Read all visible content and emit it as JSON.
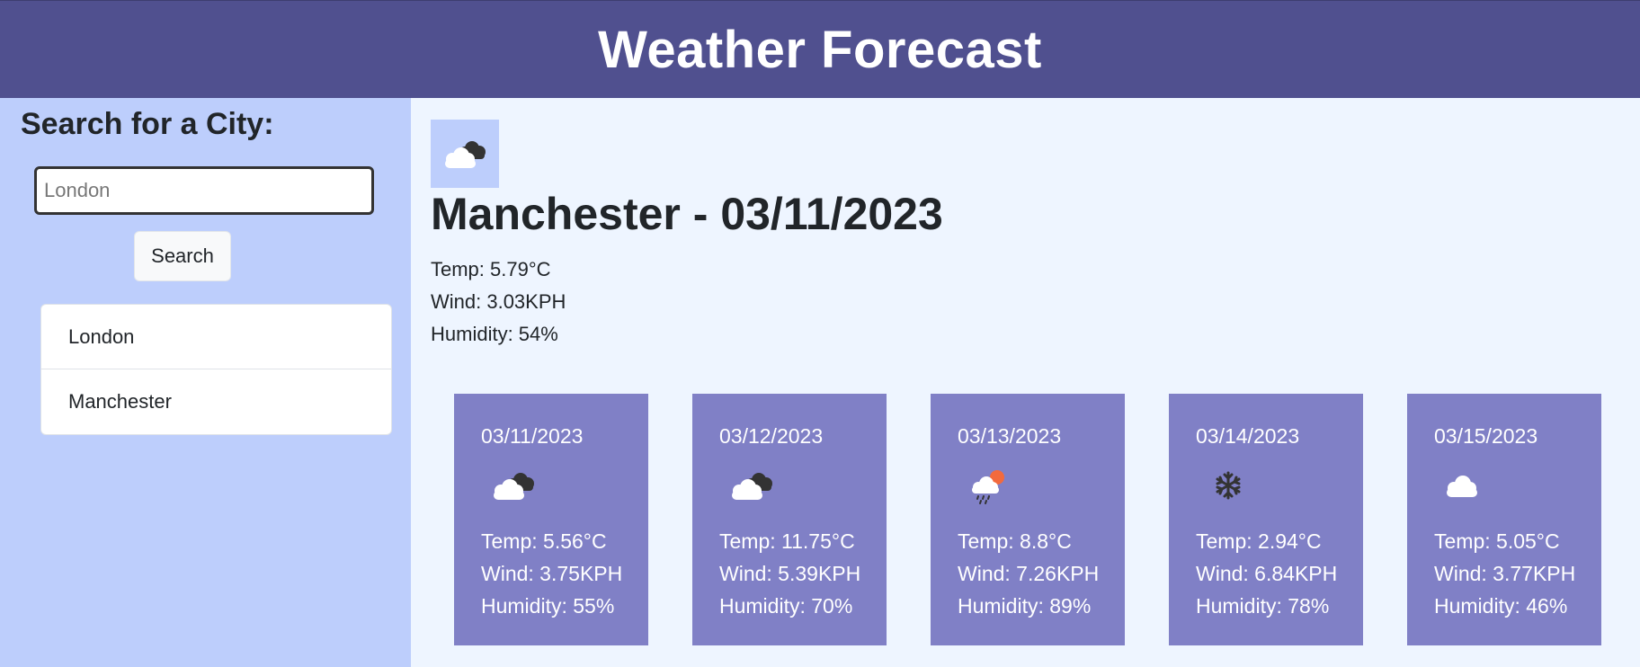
{
  "header": {
    "title": "Weather Forecast"
  },
  "sidebar": {
    "heading": "Search for a City:",
    "search_placeholder": "London",
    "search_button": "Search",
    "history": [
      "London",
      "Manchester"
    ]
  },
  "current": {
    "icon": "cloudy-icon",
    "title": "Manchester - 03/11/2023",
    "temp": "Temp: 5.79°C",
    "wind": "Wind: 3.03KPH",
    "humidity": "Humidity: 54%"
  },
  "forecast": [
    {
      "date": "03/11/2023",
      "icon": "cloudy-icon",
      "temp": "Temp: 5.56°C",
      "wind": "Wind: 3.75KPH",
      "humidity": "Humidity: 55%"
    },
    {
      "date": "03/12/2023",
      "icon": "cloudy-icon",
      "temp": "Temp: 11.75°C",
      "wind": "Wind: 5.39KPH",
      "humidity": "Humidity: 70%"
    },
    {
      "date": "03/13/2023",
      "icon": "rain-sun-icon",
      "temp": "Temp: 8.8°C",
      "wind": "Wind: 7.26KPH",
      "humidity": "Humidity: 89%"
    },
    {
      "date": "03/14/2023",
      "icon": "snow-icon",
      "temp": "Temp: 2.94°C",
      "wind": "Wind: 6.84KPH",
      "humidity": "Humidity: 78%"
    },
    {
      "date": "03/15/2023",
      "icon": "cloud-icon",
      "temp": "Temp: 5.05°C",
      "wind": "Wind: 3.77KPH",
      "humidity": "Humidity: 46%"
    }
  ],
  "colors": {
    "header_bg": "#50508f",
    "sidebar_bg": "#bdcefc",
    "main_bg": "#eef5ff",
    "card_bg": "#8080c6"
  }
}
